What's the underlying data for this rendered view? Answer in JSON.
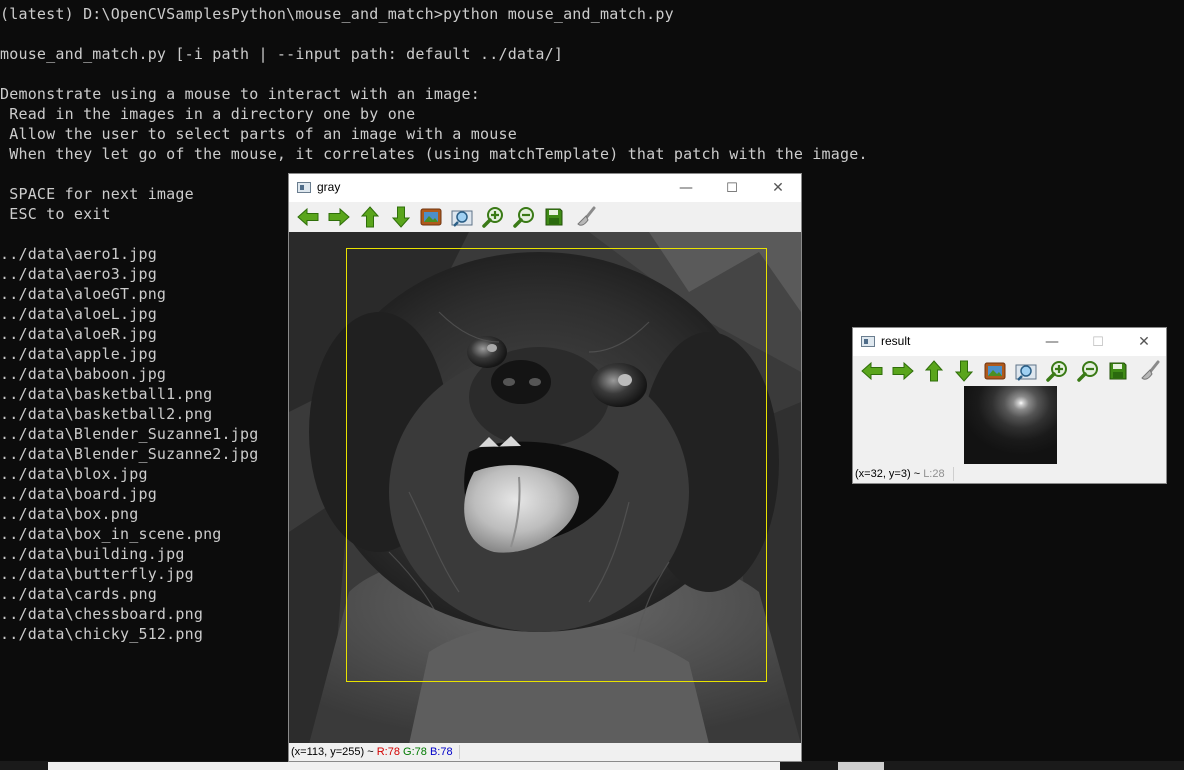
{
  "console": {
    "lines": [
      "(latest) D:\\OpenCVSamplesPython\\mouse_and_match>python mouse_and_match.py",
      "",
      "mouse_and_match.py [-i path | --input path: default ../data/]",
      "",
      "Demonstrate using a mouse to interact with an image:",
      " Read in the images in a directory one by one",
      " Allow the user to select parts of an image with a mouse",
      " When they let go of the mouse, it correlates (using matchTemplate) that patch with the image.",
      "",
      " SPACE for next image",
      " ESC to exit",
      "",
      "../data\\aero1.jpg",
      "../data\\aero3.jpg",
      "../data\\aloeGT.png",
      "../data\\aloeL.jpg",
      "../data\\aloeR.jpg",
      "../data\\apple.jpg",
      "../data\\baboon.jpg",
      "../data\\basketball1.png",
      "../data\\basketball2.png",
      "../data\\Blender_Suzanne1.jpg",
      "../data\\Blender_Suzanne2.jpg",
      "../data\\blox.jpg",
      "../data\\board.jpg",
      "../data\\box.png",
      "../data\\box_in_scene.png",
      "../data\\building.jpg",
      "../data\\butterfly.jpg",
      "../data\\cards.png",
      "../data\\chessboard.png",
      "../data\\chicky_512.png"
    ]
  },
  "windows": {
    "gray": {
      "title": "gray",
      "controls": {
        "minimize": "—",
        "maximize": "☐",
        "close": "✕"
      },
      "status": {
        "coords": "(x=113, y=255) ~",
        "r": "R:78",
        "g": "G:78",
        "b": "B:78"
      }
    },
    "result": {
      "title": "result",
      "controls": {
        "minimize": "—",
        "maximize": "☐",
        "close": "✕"
      },
      "status": {
        "coords": "(x=32, y=3) ~",
        "l": "L:28"
      }
    }
  },
  "toolbar_buttons": [
    {
      "name": "pan-left",
      "icon": "arrow-left-icon"
    },
    {
      "name": "pan-right",
      "icon": "arrow-right-icon"
    },
    {
      "name": "pan-up",
      "icon": "arrow-up-icon"
    },
    {
      "name": "pan-down",
      "icon": "arrow-down-icon"
    },
    {
      "name": "zoom-to-fit",
      "icon": "image-icon"
    },
    {
      "name": "zoom-original",
      "icon": "zoom-original-icon"
    },
    {
      "name": "zoom-in",
      "icon": "zoom-in-icon"
    },
    {
      "name": "zoom-out",
      "icon": "zoom-out-icon"
    },
    {
      "name": "save-image",
      "icon": "save-icon"
    },
    {
      "name": "properties",
      "icon": "brush-icon"
    }
  ],
  "colors": {
    "console_bg": "#0c0c0c",
    "console_text": "#cccccc",
    "selection": "#e8e200",
    "status_r": "#d40000",
    "status_g": "#007a00",
    "status_b": "#0000c8",
    "status_l": "#909090"
  }
}
